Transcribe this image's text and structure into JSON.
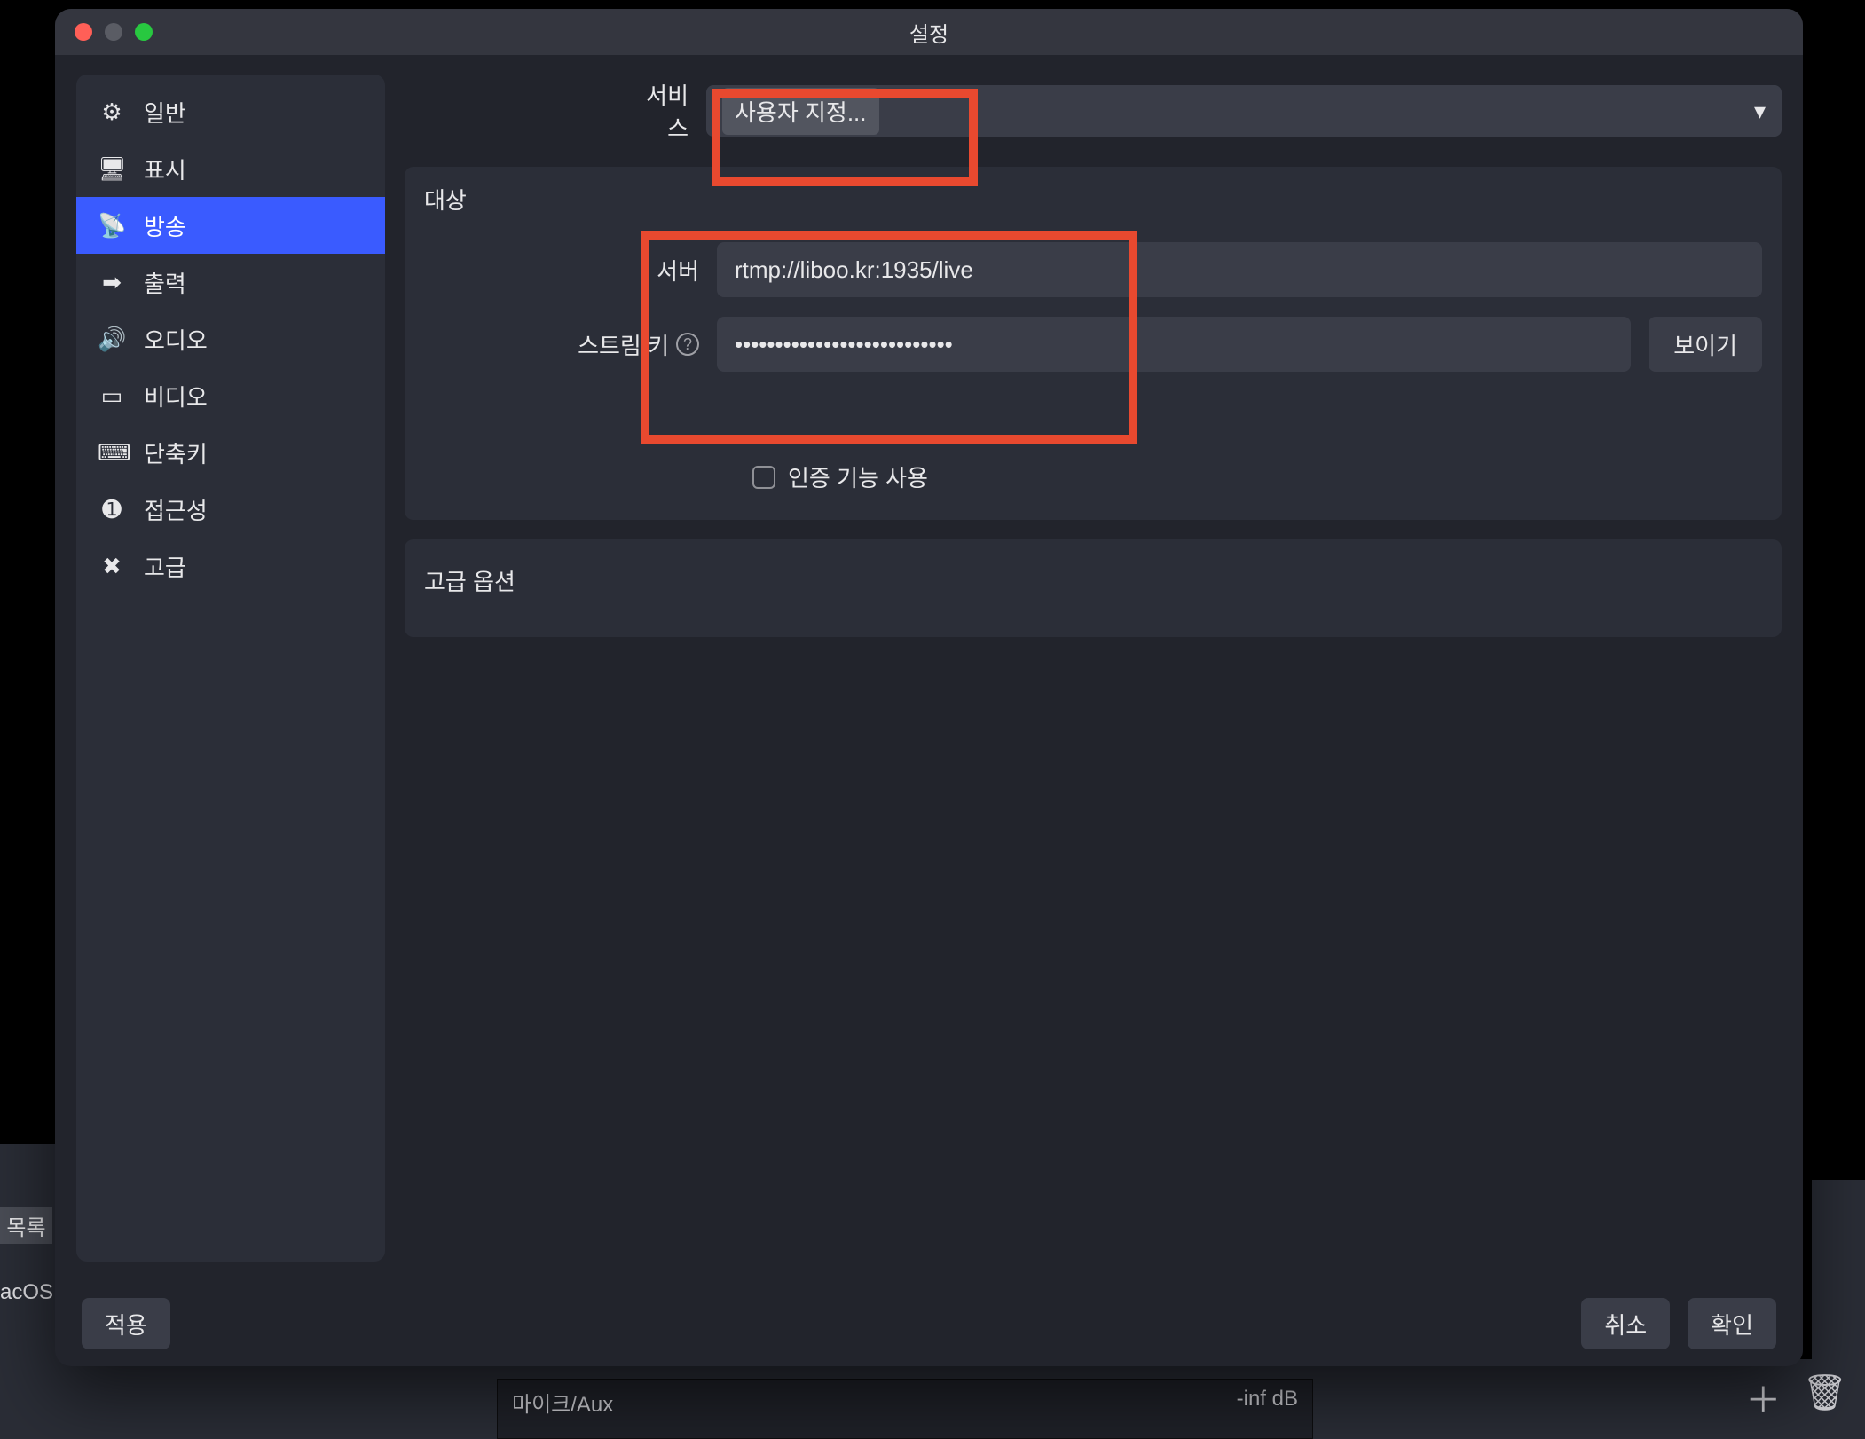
{
  "window": {
    "title": "설정"
  },
  "sidebar": {
    "items": [
      {
        "label": "일반",
        "icon": "⚙"
      },
      {
        "label": "표시",
        "icon": "🖥"
      },
      {
        "label": "방송",
        "icon": "📡"
      },
      {
        "label": "출력",
        "icon": "➡"
      },
      {
        "label": "오디오",
        "icon": "🔊"
      },
      {
        "label": "비디오",
        "icon": "▭"
      },
      {
        "label": "단축키",
        "icon": "⌨"
      },
      {
        "label": "접근성",
        "icon": "➊"
      },
      {
        "label": "고급",
        "icon": "✖"
      }
    ],
    "active_index": 2
  },
  "form": {
    "service_label": "서비스",
    "service_selected": "사용자 지정...",
    "target_section": "대상",
    "server_label": "서버",
    "server_value": "rtmp://liboo.kr:1935/live",
    "streamkey_label": "스트림 키",
    "streamkey_masked": "•••••••••••••••••••••••••••",
    "show_button": "보이기",
    "auth_checkbox_label": "인증 기능 사용",
    "auth_checked": false,
    "advanced_section": "고급 옵션"
  },
  "footer": {
    "apply": "적용",
    "cancel": "취소",
    "ok": "확인"
  },
  "background": {
    "side_tab": "목록",
    "side_text": "acOS 화",
    "mixer_label": "마이크/Aux",
    "mixer_value": "-inf dB"
  },
  "colors": {
    "accent": "#3a5bff",
    "highlight": "#e8492f"
  }
}
